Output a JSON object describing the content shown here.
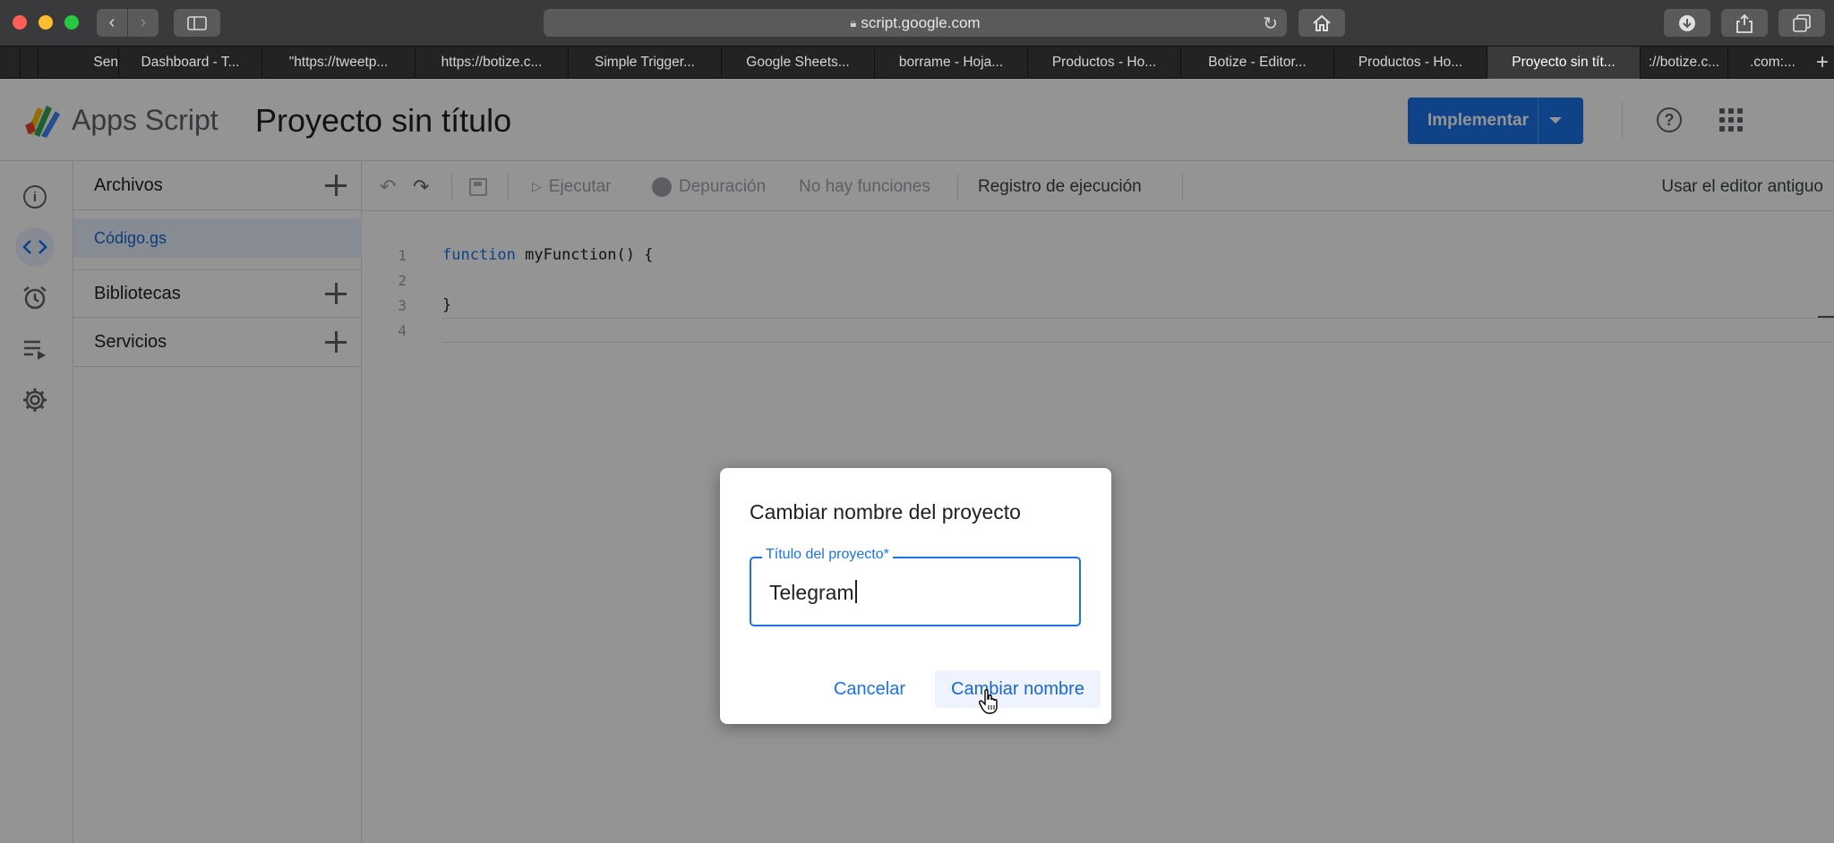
{
  "browser": {
    "url": "script.google.com",
    "tabs": [
      {
        "label": "Sen",
        "active": false
      },
      {
        "label": "Dashboard - T...",
        "active": false
      },
      {
        "label": "\"https://tweetp...",
        "active": false
      },
      {
        "label": "https://botize.c...",
        "active": false
      },
      {
        "label": "Simple Trigger...",
        "active": false
      },
      {
        "label": "Google Sheets...",
        "active": false
      },
      {
        "label": "borrame - Hoja...",
        "active": false
      },
      {
        "label": "Productos - Ho...",
        "active": false
      },
      {
        "label": "Botize - Editor...",
        "active": false
      },
      {
        "label": "Productos - Ho...",
        "active": false
      },
      {
        "label": "Proyecto sin tít...",
        "active": true
      },
      {
        "label": "://botize.c...",
        "active": false
      },
      {
        "label": ".com:...",
        "active": false
      }
    ]
  },
  "header": {
    "app_name": "Apps Script",
    "project_title": "Proyecto sin título",
    "deploy_label": "Implementar"
  },
  "files_panel": {
    "files_label": "Archivos",
    "active_file": "Código.gs",
    "libraries_label": "Bibliotecas",
    "services_label": "Servicios"
  },
  "toolbar": {
    "run_label": "Ejecutar",
    "debug_label": "Depuración",
    "no_functions_label": "No hay funciones",
    "execution_log_label": "Registro de ejecución",
    "old_editor_label": "Usar el editor antiguo"
  },
  "code": {
    "line_numbers": [
      "1",
      "2",
      "3",
      "4"
    ],
    "line1_keyword": "function",
    "line1_rest": " myFunction() {",
    "line2": "",
    "line3": "}",
    "line4": ""
  },
  "dialog": {
    "title": "Cambiar nombre del proyecto",
    "field_label": "Título del proyecto*",
    "field_value": "Telegram",
    "cancel_label": "Cancelar",
    "confirm_label": "Cambiar nombre"
  },
  "colors": {
    "accent": "#1a73e8",
    "active_file_bg": "#e8f0fe"
  }
}
